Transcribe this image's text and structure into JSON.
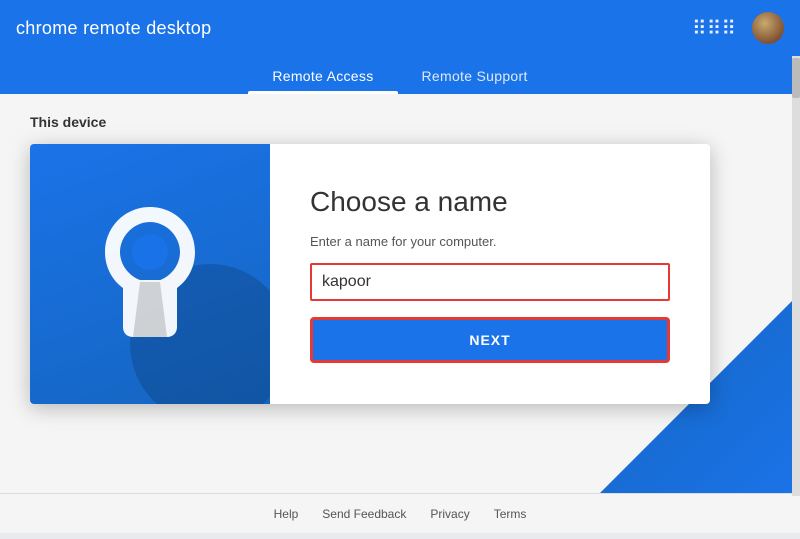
{
  "app": {
    "title": "chrome remote desktop"
  },
  "header": {
    "grid_icon": "⠿",
    "avatar_alt": "user avatar"
  },
  "tabs": [
    {
      "id": "remote-access",
      "label": "Remote Access",
      "active": true
    },
    {
      "id": "remote-support",
      "label": "Remote Support",
      "active": false
    }
  ],
  "main": {
    "section_label": "This device",
    "card": {
      "title": "Choose a name",
      "subtitle": "Enter a name for your computer.",
      "input_value": "kapoor",
      "input_placeholder": "kapoor",
      "next_button_label": "NEXT"
    }
  },
  "footer": {
    "links": [
      {
        "id": "help",
        "label": "Help"
      },
      {
        "id": "send-feedback",
        "label": "Send Feedback"
      },
      {
        "id": "privacy",
        "label": "Privacy"
      },
      {
        "id": "terms",
        "label": "Terms"
      }
    ]
  }
}
